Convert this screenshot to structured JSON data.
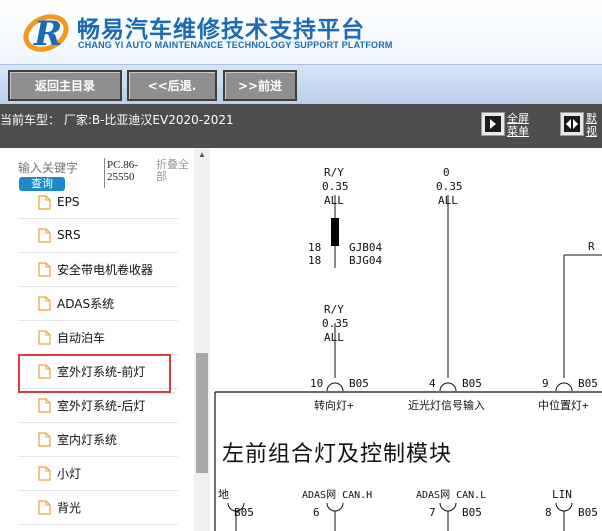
{
  "header": {
    "title": "畅易汽车维修技术支持平台",
    "subtitle": "CHANG YI AUTO MAINTENANCE TECHNOLOGY SUPPORT PLATFORM",
    "logo_letter": "R",
    "brand_color": "#1b6ab3",
    "accent_color": "#f39a1e"
  },
  "nav": {
    "back_main": "返回主目录",
    "back": "<<后退.",
    "forward": ">>前进"
  },
  "info": {
    "car_model": "当前车型： 厂家:B-比亚迪汉EV2020-2021",
    "fullscreen_l1": "全屏",
    "fullscreen_l2": "菜单",
    "default_l1": "默",
    "default_l2": "视"
  },
  "sidebar": {
    "search_placeholder": "输入关键字",
    "search_button": "查询",
    "pc_code_l1": "PC.86-",
    "pc_code_l2": "25550",
    "collapse_l1": "折叠全",
    "collapse_l2": "部",
    "items": [
      {
        "label": "EPS"
      },
      {
        "label": "SRS"
      },
      {
        "label": "安全带电机卷收器"
      },
      {
        "label": "ADAS系统"
      },
      {
        "label": "自动泊车"
      },
      {
        "label": "室外灯系统-前灯",
        "highlighted": true
      },
      {
        "label": "室外灯系统-后灯"
      },
      {
        "label": "室内灯系统"
      },
      {
        "label": "小灯"
      },
      {
        "label": "背光"
      }
    ]
  },
  "diagram": {
    "title": "左前组合灯及控制模块",
    "wire1": {
      "color": "R/Y",
      "size": "0.35",
      "circuit": "ALL"
    },
    "wire2": {
      "color": "0",
      "size": "0.35",
      "circuit": "ALL"
    },
    "wire3": {
      "color": "R/Y",
      "size": "0.35",
      "circuit": "ALL"
    },
    "connector_pin_a": "18",
    "connector_pin_b": "18",
    "connector_a": "GJB04",
    "connector_b": "BJG04",
    "right_label": "R",
    "pins_top": [
      {
        "pin": "10",
        "conn": "B05",
        "label": "转向灯+"
      },
      {
        "pin": "4",
        "conn": "B05",
        "label": "近光灯信号输入"
      },
      {
        "pin": "9",
        "conn": "B05",
        "label": "中位置灯+"
      }
    ],
    "pins_bottom": [
      {
        "pin": "",
        "conn": "B05",
        "label": "地"
      },
      {
        "pin": "6",
        "conn": "",
        "label": "ADAS网 CAN.H"
      },
      {
        "pin": "7",
        "conn": "B05",
        "label": "ADAS网 CAN.L"
      },
      {
        "pin": "8",
        "conn": "B05",
        "label": "LIN"
      }
    ]
  }
}
